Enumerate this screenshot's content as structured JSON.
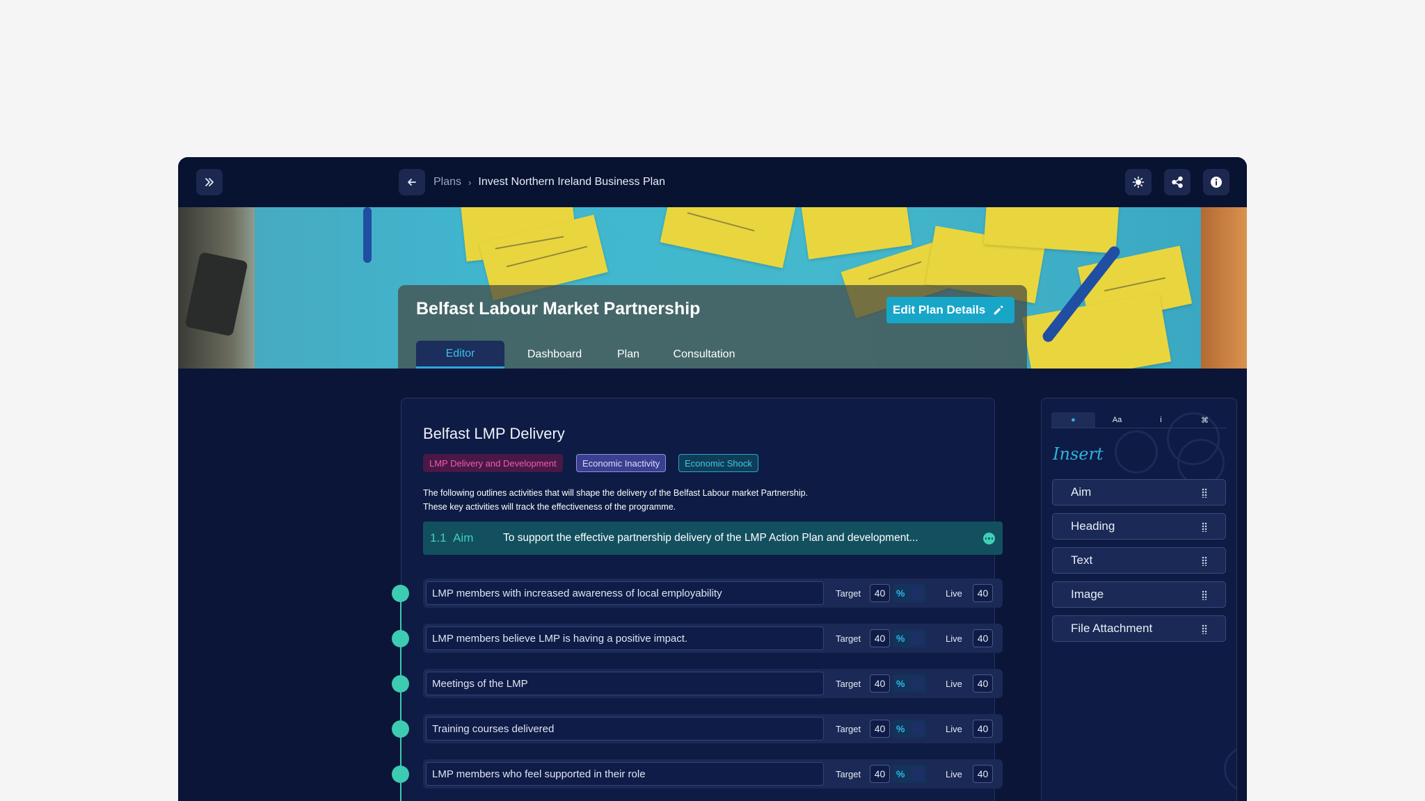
{
  "breadcrumb": {
    "root": "Plans",
    "current": "Invest Northern Ireland Business Plan"
  },
  "toolbar": {
    "expand_icon": "chevrons-right-icon",
    "back_icon": "arrow-left-icon",
    "theme_icon": "sun-icon",
    "share_icon": "share-icon",
    "info_icon": "info-icon"
  },
  "plan": {
    "title": "Belfast Labour Market Partnership",
    "edit_label": "Edit Plan Details",
    "tabs": [
      "Editor",
      "Dashboard",
      "Plan",
      "Consultation"
    ],
    "active_tab": "Editor"
  },
  "editor": {
    "title": "Belfast LMP Delivery",
    "tags": [
      "LMP Delivery and Development",
      "Economic Inactivity",
      "Economic Shock"
    ],
    "description": [
      "The following outlines activities that will shape the delivery of the Belfast Labour market Partnership.",
      "These key activities will track the effectiveness of the programme."
    ],
    "aim": {
      "number": "1.1",
      "label": "Aim",
      "text": "To support the effective partnership delivery of the LMP Action Plan and development..."
    },
    "target_label": "Target",
    "percent_symbol": "%",
    "live_label": "Live",
    "rows": [
      {
        "text": "LMP members with increased awareness of local employability",
        "target": "40",
        "live": "40"
      },
      {
        "text": "LMP members believe LMP is having a positive impact.",
        "target": "40",
        "live": "40"
      },
      {
        "text": "Meetings of the LMP",
        "target": "40",
        "live": "40"
      },
      {
        "text": "Training courses delivered",
        "target": "40",
        "live": "40"
      },
      {
        "text": "LMP members who feel supported in their role",
        "target": "40",
        "live": "40"
      }
    ]
  },
  "insert_panel": {
    "tabs": [
      "●",
      "Aa",
      "i",
      "⌘"
    ],
    "title": "Insert",
    "items": [
      "Aim",
      "Heading",
      "Text",
      "Image",
      "File Attachment"
    ]
  },
  "colors": {
    "app_bg": "#0b1538",
    "accent_teal": "#3dcbb2",
    "accent_blue": "#18a6c8",
    "tag_pink": "#ee5ab8",
    "tag_violet": "#8c91e8",
    "tag_cyan": "#40c6ea"
  }
}
